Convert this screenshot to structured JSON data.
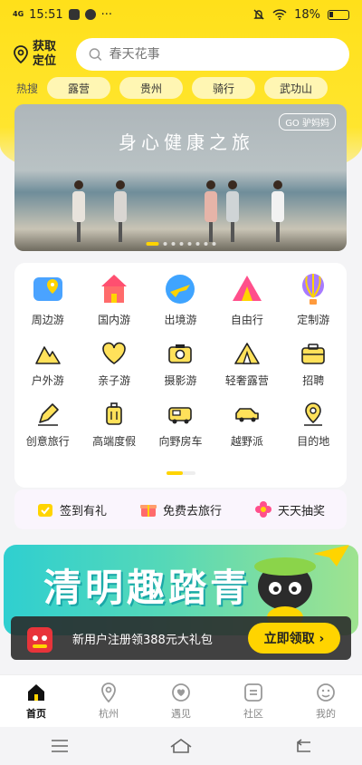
{
  "status": {
    "time": "15:51",
    "network": "4G",
    "battery": "18%"
  },
  "header": {
    "location_label": "获取定位",
    "search_placeholder": "春天花事"
  },
  "hot_search": {
    "label": "热搜",
    "tags": [
      "露营",
      "贵州",
      "骑行",
      "武功山"
    ]
  },
  "banner": {
    "slogan": "身心健康之旅",
    "brand": "GO 驴妈妈",
    "slide_count": 8,
    "active_slide": 0
  },
  "categories": [
    {
      "label": "周边游",
      "icon": "map-pin-icon"
    },
    {
      "label": "国内游",
      "icon": "castle-icon"
    },
    {
      "label": "出境游",
      "icon": "globe-plane-icon"
    },
    {
      "label": "自由行",
      "icon": "tent-icon"
    },
    {
      "label": "定制游",
      "icon": "hot-air-balloon-icon"
    },
    {
      "label": "户外游",
      "icon": "mountain-icon"
    },
    {
      "label": "亲子游",
      "icon": "heart-icon"
    },
    {
      "label": "摄影游",
      "icon": "camera-icon"
    },
    {
      "label": "轻奢露营",
      "icon": "camping-tent-icon"
    },
    {
      "label": "招聘",
      "icon": "briefcase-icon"
    },
    {
      "label": "创意旅行",
      "icon": "pencil-icon"
    },
    {
      "label": "高端度假",
      "icon": "luggage-icon"
    },
    {
      "label": "向野房车",
      "icon": "rv-icon"
    },
    {
      "label": "越野派",
      "icon": "suv-icon"
    },
    {
      "label": "目的地",
      "icon": "location-icon"
    }
  ],
  "quick_actions": [
    {
      "label": "签到有礼",
      "icon": "calendar-check-icon"
    },
    {
      "label": "免费去旅行",
      "icon": "gift-box-icon"
    },
    {
      "label": "天天抽奖",
      "icon": "flower-icon"
    }
  ],
  "promo": {
    "title": "清明趣踏青"
  },
  "popup": {
    "text": "新用户注册领388元大礼包",
    "button": "立即领取 ›"
  },
  "tabs": [
    {
      "label": "首页",
      "icon": "home-icon",
      "active": true
    },
    {
      "label": "杭州",
      "icon": "location-icon",
      "active": false
    },
    {
      "label": "遇见",
      "icon": "discover-icon",
      "active": false
    },
    {
      "label": "社区",
      "icon": "community-icon",
      "active": false
    },
    {
      "label": "我的",
      "icon": "profile-icon",
      "active": false
    }
  ],
  "colors": {
    "accent": "#ffd400",
    "header_bg": "#ffe01a"
  }
}
